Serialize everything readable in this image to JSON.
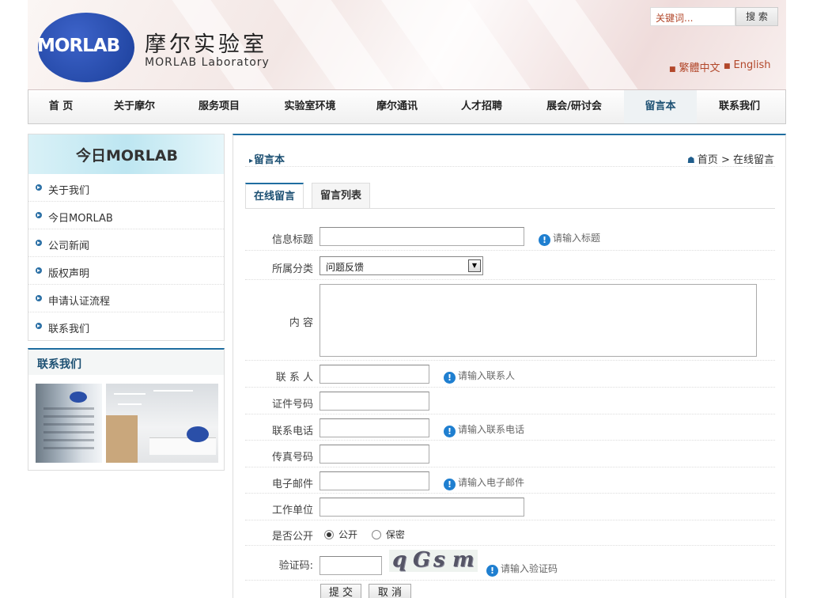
{
  "header": {
    "logo_text": "MORLAB",
    "logo_cn": "摩尔实验室",
    "logo_en": "MORLAB Laboratory",
    "search_placeholder": "关键词...",
    "search_label": "搜 索",
    "lang_traditional": "繁體中文",
    "lang_english": "English"
  },
  "nav": {
    "items": [
      "首 页",
      "关于摩尔",
      "服务项目",
      "实验室环境",
      "摩尔通讯",
      "人才招聘",
      "展会/研讨会",
      "留言本",
      "联系我们"
    ],
    "active_index": 7
  },
  "sidebar": {
    "title": "今日MORLAB",
    "items": [
      "关于我们",
      "今日MORLAB",
      "公司新闻",
      "版权声明",
      "申请认证流程",
      "联系我们"
    ],
    "contact_title": "联系我们"
  },
  "main": {
    "section_title": "留言本",
    "breadcrumb_home": "首页",
    "breadcrumb_sep": ">",
    "breadcrumb_current": "在线留言",
    "tabs": [
      "在线留言",
      "留言列表"
    ],
    "active_tab": 0
  },
  "form": {
    "title_label": "信息标题",
    "title_hint": "请输入标题",
    "category_label": "所属分类",
    "category_value": "问题反馈",
    "content_label": "内 容",
    "contact_label": "联 系 人",
    "contact_hint": "请输入联系人",
    "id_label": "证件号码",
    "phone_label": "联系电话",
    "phone_hint": "请输入联系电话",
    "fax_label": "传真号码",
    "email_label": "电子邮件",
    "email_hint": "请输入电子邮件",
    "company_label": "工作单位",
    "public_label": "是否公开",
    "public_option": "公开",
    "private_option": "保密",
    "public_selected": true,
    "captcha_label": "验证码:",
    "captcha_text": "qGsm",
    "captcha_hint": "请输入验证码",
    "submit_label": "提 交",
    "cancel_label": "取 消"
  },
  "colors": {
    "accent": "#1f6da0",
    "brand_blue": "#1b3f9a",
    "link_red": "#b2472a"
  }
}
